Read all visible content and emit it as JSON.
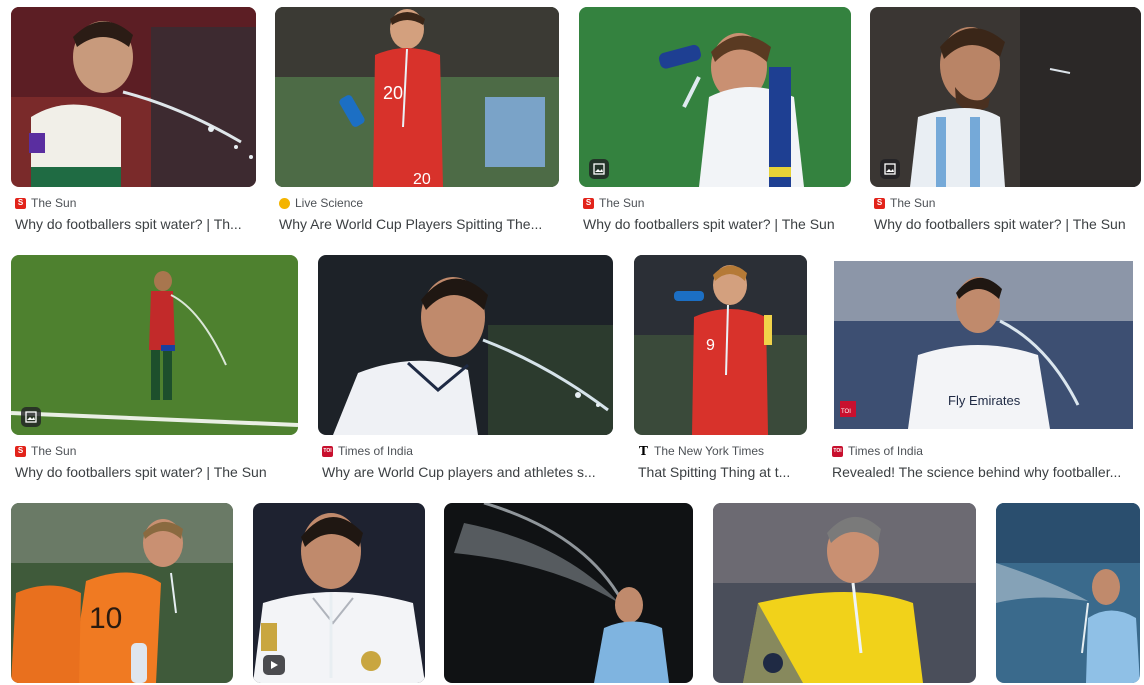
{
  "results": [
    {
      "source": "The Sun",
      "favicon": "sun",
      "title": "Why do footballers spit water? | Th...",
      "badge": null
    },
    {
      "source": "Live Science",
      "favicon": "ls",
      "title": "Why Are World Cup Players Spitting The...",
      "badge": null
    },
    {
      "source": "The Sun",
      "favicon": "sun",
      "title": "Why do footballers spit water? | The Sun",
      "badge": "image-icon"
    },
    {
      "source": "The Sun",
      "favicon": "sun",
      "title": "Why do footballers spit water? | The Sun",
      "badge": "image-icon"
    },
    {
      "source": "The Sun",
      "favicon": "sun",
      "title": "Why do footballers spit water? | The Sun",
      "badge": "image-icon"
    },
    {
      "source": "Times of India",
      "favicon": "toi",
      "title": "Why are World Cup players and athletes s...",
      "badge": null
    },
    {
      "source": "The New York Times",
      "favicon": "nyt",
      "title": "That Spitting Thing at t...",
      "badge": null
    },
    {
      "source": "Times of India",
      "favicon": "toi",
      "title": "Revealed! The science behind why footballer...",
      "badge": null
    },
    {
      "source": "",
      "favicon": "",
      "title": "",
      "badge": null
    },
    {
      "source": "",
      "favicon": "",
      "title": "",
      "badge": "video-icon"
    },
    {
      "source": "",
      "favicon": "",
      "title": "",
      "badge": null
    },
    {
      "source": "",
      "favicon": "",
      "title": "",
      "badge": null
    },
    {
      "source": "",
      "favicon": "",
      "title": "",
      "badge": null
    }
  ],
  "thumb_text": {
    "shirt_20": "20",
    "shirt_9": "9",
    "shirt_10": "10",
    "fly_emirates": "Fly Emirates",
    "toi_logo": "TOI"
  }
}
